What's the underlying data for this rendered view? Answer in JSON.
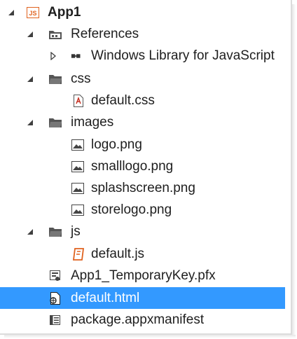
{
  "tree": {
    "root": {
      "label": "App1",
      "icon": "javascript-project-icon"
    },
    "references": {
      "label": "References",
      "icon": "references-folder-icon"
    },
    "winjs": {
      "label": "Windows Library for JavaScript",
      "icon": "library-reference-icon"
    },
    "css": {
      "label": "css",
      "icon": "folder-icon"
    },
    "default_css": {
      "label": "default.css",
      "icon": "css-file-icon"
    },
    "images": {
      "label": "images",
      "icon": "folder-icon"
    },
    "logo": {
      "label": "logo.png",
      "icon": "image-file-icon"
    },
    "smalllogo": {
      "label": "smalllogo.png",
      "icon": "image-file-icon"
    },
    "splashscreen": {
      "label": "splashscreen.png",
      "icon": "image-file-icon"
    },
    "storelogo": {
      "label": "storelogo.png",
      "icon": "image-file-icon"
    },
    "js": {
      "label": "js",
      "icon": "folder-icon"
    },
    "default_js": {
      "label": "default.js",
      "icon": "javascript-file-icon"
    },
    "pfx": {
      "label": "App1_TemporaryKey.pfx",
      "icon": "certificate-key-icon"
    },
    "default_html": {
      "label": "default.html",
      "icon": "html-file-icon"
    },
    "manifest": {
      "label": "package.appxmanifest",
      "icon": "manifest-file-icon"
    }
  },
  "colors": {
    "selection": "#3399ff",
    "js_accent": "#e0621e",
    "folder": "#555555"
  }
}
